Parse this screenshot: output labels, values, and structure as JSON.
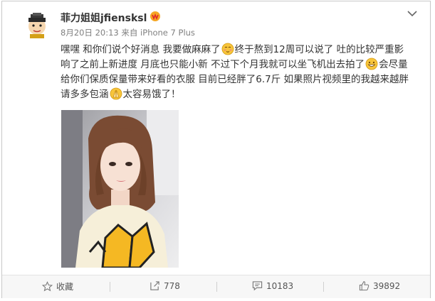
{
  "post": {
    "username": "菲力姐姐jfiensksl",
    "time": "8月20日 20:13",
    "source": "来自 iPhone 7 Plus",
    "text_1": "嘿嘿 和你们说个好消息 我要做麻麻了",
    "text_2": "终于熬到12周可以说了 吐的比较严重影响了之前上新进度 月底也只能小新 不过下个月我就可以坐飞机出去拍了",
    "text_3": "会尽量给你们保质保量带来好看的衣服 目前已经胖了6.7斤 如果照片视频里的我越来越胖 请多多包涵",
    "text_4": "太容易饿了！"
  },
  "footer": {
    "favorite_label": "收藏",
    "repost_count": "778",
    "comment_count": "10183",
    "like_count": "39892"
  },
  "colors": {
    "accent": "#f5a623",
    "text": "#333333",
    "muted": "#808080"
  }
}
